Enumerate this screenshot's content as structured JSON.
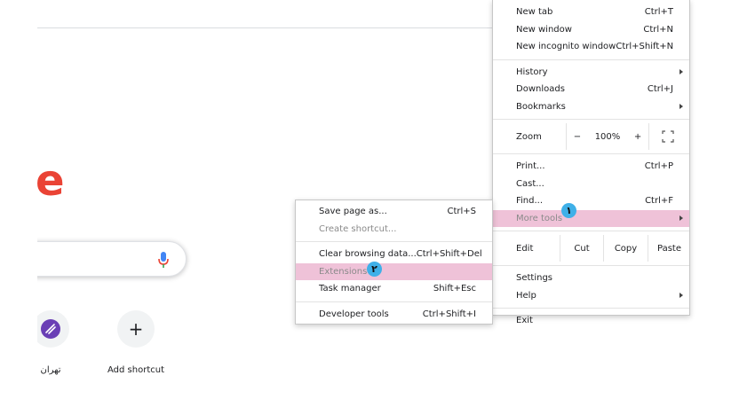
{
  "new_tab_page": {
    "logo_fragment": "e",
    "shortcuts": [
      {
        "label": "تهران",
        "icon": "purple-app-icon"
      },
      {
        "label": "Add shortcut",
        "icon": "plus-icon",
        "glyph": "+"
      }
    ]
  },
  "main_menu": {
    "new_tab": {
      "label": "New tab",
      "shortcut": "Ctrl+T"
    },
    "new_window": {
      "label": "New window",
      "shortcut": "Ctrl+N"
    },
    "new_incognito": {
      "label": "New incognito window",
      "shortcut": "Ctrl+Shift+N"
    },
    "history": {
      "label": "History"
    },
    "downloads": {
      "label": "Downloads",
      "shortcut": "Ctrl+J"
    },
    "bookmarks": {
      "label": "Bookmarks"
    },
    "zoom": {
      "label": "Zoom",
      "minus": "−",
      "level": "100%",
      "plus": "+"
    },
    "print": {
      "label": "Print...",
      "shortcut": "Ctrl+P"
    },
    "cast": {
      "label": "Cast..."
    },
    "find": {
      "label": "Find...",
      "shortcut": "Ctrl+F"
    },
    "more_tools": {
      "label": "More tools"
    },
    "edit": {
      "label": "Edit",
      "cut": "Cut",
      "copy": "Copy",
      "paste": "Paste"
    },
    "settings": {
      "label": "Settings"
    },
    "help": {
      "label": "Help"
    },
    "exit": {
      "label": "Exit"
    }
  },
  "sub_menu": {
    "save_page": {
      "label": "Save page as...",
      "shortcut": "Ctrl+S"
    },
    "create_shortcut": {
      "label": "Create shortcut..."
    },
    "clear_browsing": {
      "label": "Clear browsing data...",
      "shortcut": "Ctrl+Shift+Del"
    },
    "extensions": {
      "label": "Extensions"
    },
    "task_manager": {
      "label": "Task manager",
      "shortcut": "Shift+Esc"
    },
    "developer_tools": {
      "label": "Developer tools",
      "shortcut": "Ctrl+Shift+I"
    }
  },
  "badges": {
    "step1": "١",
    "step2": "٢"
  },
  "colors": {
    "highlight": "#efc2d8",
    "badge": "#3fb0e8",
    "logo_red": "#ea4335"
  }
}
